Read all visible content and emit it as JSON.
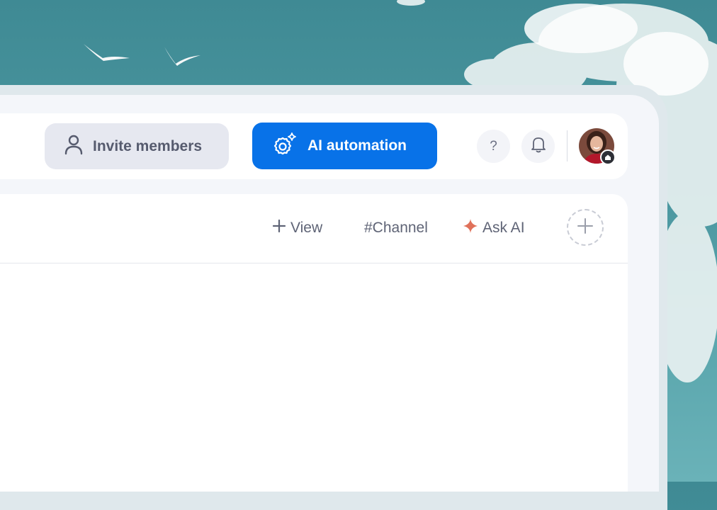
{
  "header": {
    "invite_label": "Invite members",
    "ai_label": "AI automation",
    "help_glyph": "?"
  },
  "tabs": {
    "view_label": "View",
    "channel_label": "#Channel",
    "ask_ai_label": "Ask AI"
  },
  "colors": {
    "ai_button": "#0872e8",
    "invite_button": "#e6e8f0",
    "sparkle": "#e0715a",
    "background_sky": "#4b97a0"
  },
  "icons": [
    "person-icon",
    "gear-sparkle-icon",
    "bell-icon",
    "plus-icon",
    "sparkle-icon"
  ]
}
